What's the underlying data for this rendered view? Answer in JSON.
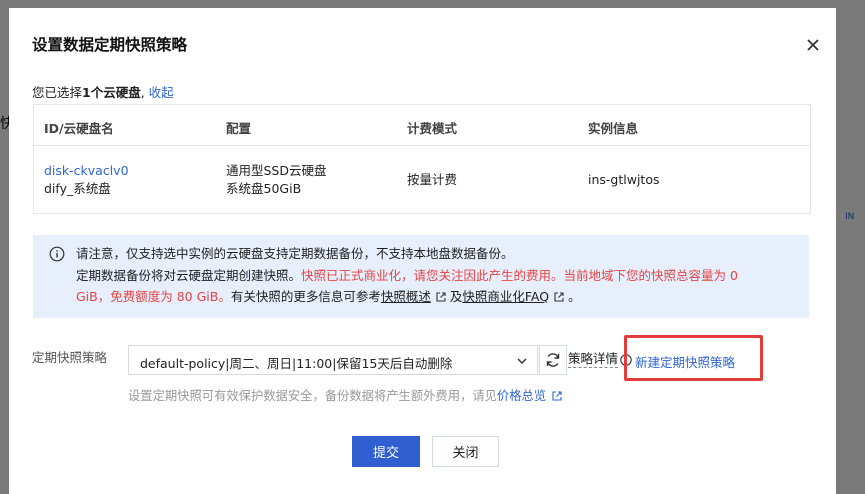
{
  "background": {
    "fragments": [
      "快",
      "IN"
    ]
  },
  "dialog": {
    "title": "设置数据定期快照策略",
    "selected": {
      "prefix": "您已选择",
      "count": "1个云硬盘",
      "separator": ", ",
      "collapse_link": "收起"
    },
    "table": {
      "headers": [
        "ID/云硬盘名",
        "配置",
        "计费模式",
        "实例信息"
      ],
      "rows": [
        {
          "disk_id": "disk-ckvaclv0",
          "disk_name": "dify_系统盘",
          "config_type": "通用型SSD云硬盘",
          "config_size": "系统盘50GiB",
          "billing": "按量计费",
          "instance": "ins-gtlwjtos"
        }
      ]
    },
    "notice": {
      "line1": "请注意，仅支持选中实例的云硬盘支持定期数据备份，不支持本地盘数据备份。",
      "line2_normal": "定期数据备份将对云硬盘定期创建快照。",
      "line2_red": "快照已正式商业化，请您关注因此产生的费用。当前地域下您的快照总容量为 0",
      "line3_red": "GiB，免费额度为 80 GiB。",
      "line3_normal": "有关快照的更多信息可参考",
      "link_overview": "快照概述",
      "and": "及",
      "link_faq": "快照商业化FAQ",
      "end": "。"
    },
    "policy": {
      "label": "定期快照策略",
      "selected_value": "default-policy|周二、周日|11:00|保留15天后自动删除",
      "detail_link": "策略详情",
      "new_policy_link": "新建定期快照策略",
      "hint_text": "设置定期快照可有效保护数据安全，备份数据将产生额外费用，请见",
      "price_link": "价格总览"
    },
    "buttons": {
      "submit": "提交",
      "close": "关闭"
    }
  },
  "colors": {
    "accent": "#2f5fd0",
    "link": "#2f66d6",
    "warning_red": "#e54545",
    "notice_bg": "#e7eefc",
    "highlight_box": "#e23c3c"
  },
  "icons": [
    "close-icon",
    "info-icon",
    "external-link-icon",
    "chevron-down-icon",
    "refresh-icon",
    "help-icon"
  ]
}
